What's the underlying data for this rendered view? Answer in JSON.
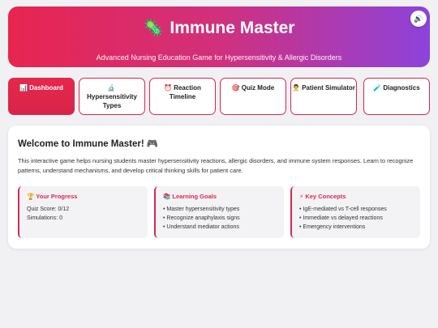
{
  "header": {
    "icon": "🦠",
    "title": "Immune Master",
    "subtitle": "Advanced Nursing Education Game for Hypersensitivity & Allergic Disorders",
    "sound_icon": "🔊"
  },
  "tabs": [
    {
      "icon": "📊",
      "label": "Dashboard",
      "active": true
    },
    {
      "icon": "🔬",
      "label": "Hypersensitivity Types",
      "active": false
    },
    {
      "icon": "⏰",
      "label": "Reaction Timeline",
      "active": false
    },
    {
      "icon": "🎯",
      "label": "Quiz Mode",
      "active": false
    },
    {
      "icon": "👨‍⚕️",
      "label": "Patient Simulator",
      "active": false
    },
    {
      "icon": "🧪",
      "label": "Diagnostics",
      "active": false
    }
  ],
  "main": {
    "heading": "Welcome to Immune Master! 🎮",
    "intro": "This interactive game helps nursing students master hypersensitivity reactions, allergic disorders, and immune system responses. Learn to recognize patterns, understand mechanisms, and develop critical thinking skills for patient care.",
    "cards": [
      {
        "title": "🏆 Your Progress",
        "lines": [
          "Quiz Score: 0/12",
          "Simulations: 0"
        ]
      },
      {
        "title": "📚 Learning Goals",
        "lines": [
          "• Master hypersensitivity types",
          "• Recognize anaphylaxis signs",
          "• Understand mediator actions"
        ]
      },
      {
        "title": "⚡ Key Concepts",
        "lines": [
          "• IgE-mediated vs T-cell responses",
          "• Immediate vs delayed reactions",
          "• Emergency interventions"
        ]
      }
    ]
  },
  "colors": {
    "accent": "#d9284e",
    "gradient_start": "#e8254f",
    "gradient_end": "#8d43dc"
  }
}
